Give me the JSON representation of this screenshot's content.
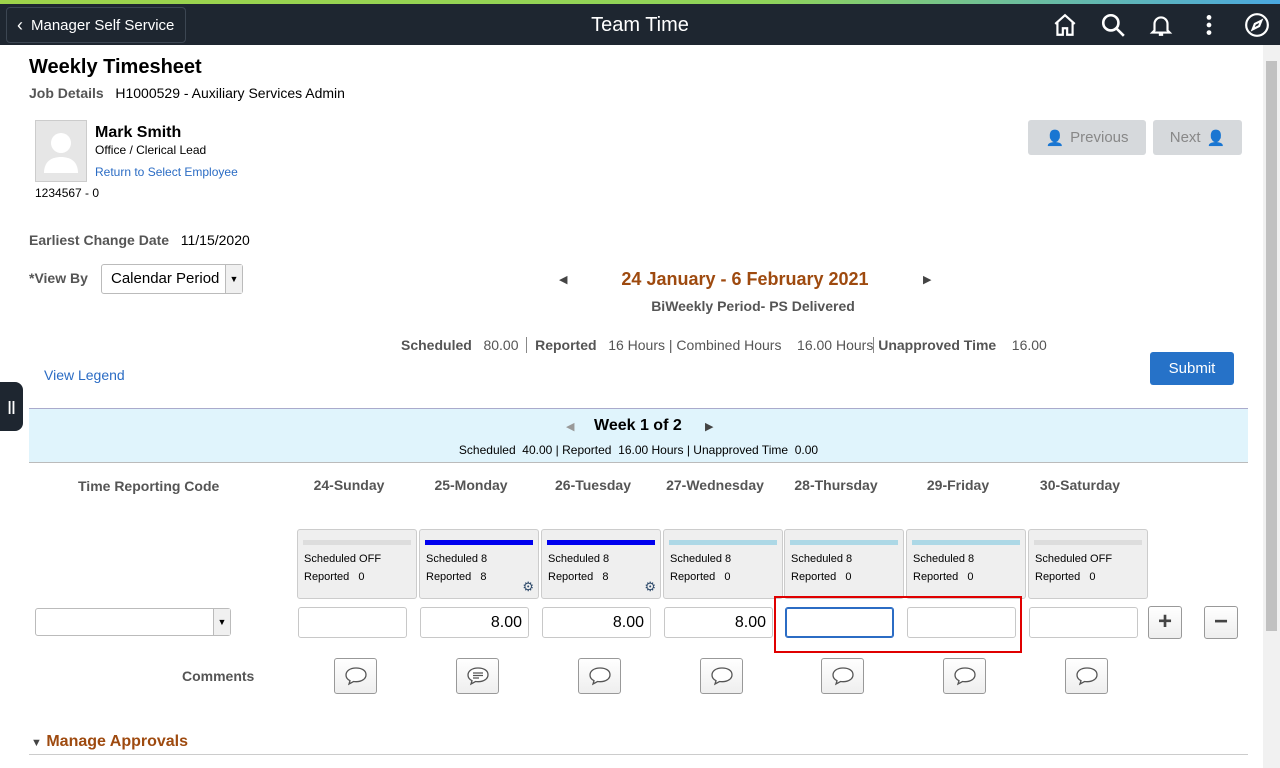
{
  "header": {
    "back_label": "Manager Self Service",
    "title": "Team Time",
    "icons": [
      "home-icon",
      "search-icon",
      "bell-icon",
      "more-vertical-icon",
      "compass-icon"
    ]
  },
  "page": {
    "title": "Weekly Timesheet",
    "job_details_label": "Job Details",
    "job_details_value": "H1000529 - Auxiliary Services Admin"
  },
  "employee": {
    "name": "Mark Smith",
    "title": "Office / Clerical Lead",
    "return_link": "Return to Select Employee",
    "id": "1234567 - 0"
  },
  "nav": {
    "previous": "Previous",
    "next": "Next"
  },
  "earliest_change": {
    "label": "Earliest Change Date",
    "value": "11/15/2020"
  },
  "view_by": {
    "label": "*View By",
    "value": "Calendar Period"
  },
  "period": {
    "title": "24 January - 6 February 2021",
    "subtitle": "BiWeekly Period- PS Delivered",
    "scheduled_label": "Scheduled",
    "scheduled_value": "80.00",
    "reported_label": "Reported",
    "reported_value": "16 Hours | Combined Hours",
    "combined_value": "16.00 Hours",
    "unapproved_label": "Unapproved Time",
    "unapproved_value": "16.00"
  },
  "view_legend": "View Legend",
  "submit": "Submit",
  "week": {
    "title": "Week 1 of 2",
    "summary": "Scheduled  40.00 | Reported  16.00 Hours | Unapproved Time  0.00"
  },
  "grid": {
    "trc_label": "Time Reporting Code",
    "trc_value": "",
    "comments_label": "Comments",
    "days": [
      {
        "label": "24-Sunday",
        "scheduled": "Scheduled OFF",
        "reported": "Reported   0",
        "bar": "#dddddd",
        "hours": "",
        "gear": false,
        "comment": "empty"
      },
      {
        "label": "25-Monday",
        "scheduled": "Scheduled 8",
        "reported": "Reported   8",
        "bar": "#0000ee",
        "hours": "8.00",
        "gear": true,
        "comment": "filled"
      },
      {
        "label": "26-Tuesday",
        "scheduled": "Scheduled 8",
        "reported": "Reported   8",
        "bar": "#0000ee",
        "hours": "8.00",
        "gear": true,
        "comment": "empty"
      },
      {
        "label": "27-Wednesday",
        "scheduled": "Scheduled 8",
        "reported": "Reported   0",
        "bar": "#add8e6",
        "hours": "8.00",
        "gear": false,
        "comment": "empty"
      },
      {
        "label": "28-Thursday",
        "scheduled": "Scheduled 8",
        "reported": "Reported   0",
        "bar": "#add8e6",
        "hours": "",
        "gear": false,
        "comment": "empty"
      },
      {
        "label": "29-Friday",
        "scheduled": "Scheduled 8",
        "reported": "Reported   0",
        "bar": "#add8e6",
        "hours": "",
        "gear": false,
        "comment": "empty"
      },
      {
        "label": "30-Saturday",
        "scheduled": "Scheduled OFF",
        "reported": "Reported   0",
        "bar": "#dddddd",
        "hours": "",
        "gear": false,
        "comment": "empty"
      }
    ]
  },
  "manage_approvals": "Manage Approvals",
  "colors": {
    "accent": "#9e4a0f",
    "link": "#2b6cc4",
    "submit": "#2672c8",
    "highlight": "#e00000"
  }
}
